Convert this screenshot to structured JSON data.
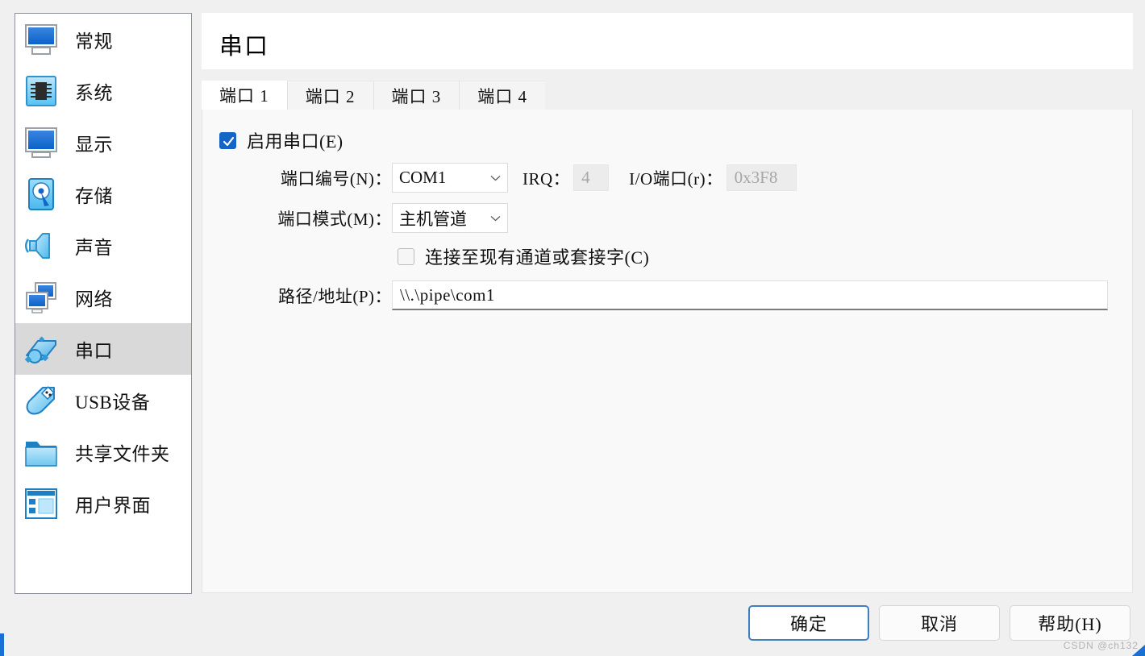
{
  "window": {
    "title": "串口",
    "watermark": "CSDN @ch132"
  },
  "sidebar": {
    "items": [
      {
        "label": "常规",
        "icon": "monitor-general-icon",
        "selected": false
      },
      {
        "label": "系统",
        "icon": "chip-system-icon",
        "selected": false
      },
      {
        "label": "显示",
        "icon": "display-icon",
        "selected": false
      },
      {
        "label": "存储",
        "icon": "harddisk-storage-icon",
        "selected": false
      },
      {
        "label": "声音",
        "icon": "speaker-audio-icon",
        "selected": false
      },
      {
        "label": "网络",
        "icon": "network-icon",
        "selected": false
      },
      {
        "label": "串口",
        "icon": "serial-port-icon",
        "selected": true
      },
      {
        "label": "USB设备",
        "icon": "usb-icon",
        "selected": false
      },
      {
        "label": "共享文件夹",
        "icon": "folder-shared-icon",
        "selected": false
      },
      {
        "label": "用户界面",
        "icon": "user-interface-icon",
        "selected": false
      }
    ]
  },
  "tabs": [
    {
      "label": "端口 1",
      "active": true
    },
    {
      "label": "端口 2",
      "active": false
    },
    {
      "label": "端口 3",
      "active": false
    },
    {
      "label": "端口 4",
      "active": false
    }
  ],
  "form": {
    "enable_port": {
      "label": "启用串口(E)",
      "checked": true
    },
    "port_number": {
      "label": "端口编号(N)：",
      "value": "COM1"
    },
    "irq": {
      "label": "IRQ：",
      "value": "4"
    },
    "io_port": {
      "label": "I/O端口(r)：",
      "value": "0x3F8"
    },
    "port_mode": {
      "label": "端口模式(M)：",
      "value": "主机管道"
    },
    "connect_existing": {
      "label": "连接至现有通道或套接字(C)",
      "checked": false
    },
    "path_address": {
      "label": "路径/地址(P)：",
      "value": "\\\\.\\pipe\\com1"
    }
  },
  "buttons": [
    {
      "label": "确定",
      "default": true
    },
    {
      "label": "取消",
      "default": false
    },
    {
      "label": "帮助(H)",
      "default": false
    }
  ],
  "colors": {
    "accent": "#1565c7",
    "selection": "#d9d9d9",
    "focus_border": "#3e7fc1"
  }
}
